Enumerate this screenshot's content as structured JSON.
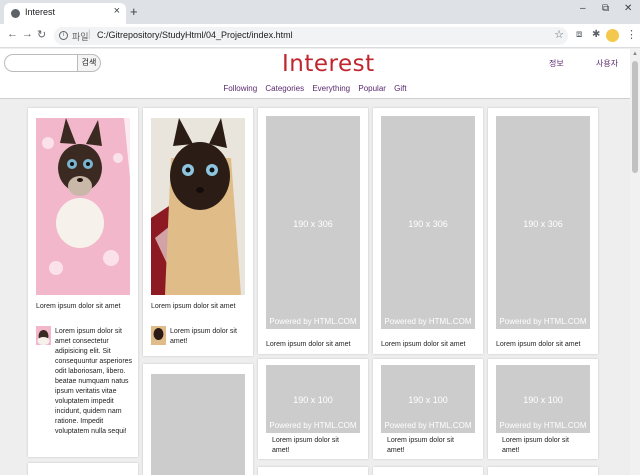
{
  "browser": {
    "tab_title": "Interest",
    "new_tab": "+",
    "tab_close": "×",
    "url_scheme": "파일",
    "url_separator": "|",
    "url": "C:/Gitrepository/StudyHtml/04_Project/index.html",
    "info_icon": "i",
    "window_min": "–",
    "window_max": "⧉",
    "window_close": "✕",
    "back": "←",
    "forward": "→",
    "reload": "↻",
    "star": "☆",
    "ext_puzzle": "✱",
    "ext_box": "⧈",
    "menu": "⋮"
  },
  "header": {
    "search_placeholder": "",
    "search_button": "검색",
    "logo": "Interest",
    "info_link": "정보",
    "user_link": "사용자"
  },
  "nav": {
    "items": [
      "Following",
      "Categories",
      "Everything",
      "Popular",
      "Gift"
    ]
  },
  "cards": {
    "c1": {
      "title": "Lorem ipsum dolor sit amet",
      "desc_lines": [
        "Lorem ipsum dolor sit",
        "amet consectetur",
        "adipisicing elit. Sit",
        "consequuntur asperiores",
        "odit laboriosam, libero.",
        "beatae numquam natus",
        "ipsum veritatis vitae",
        "voluptatem impedit",
        "incidunt, quidem nam",
        "ratione. Impedit",
        "voluptatem nulla sequi!"
      ]
    },
    "c2": {
      "title": "Lorem ipsum dolor sit amet",
      "desc_lines": [
        "Lorem ipsum dolor sit",
        "amet!"
      ]
    },
    "placeholders": {
      "large_size": "190 x 306",
      "small_size": "190 x 100",
      "credit": "Powered by HTML.COM",
      "title": "Lorem ipsum dolor sit amet",
      "small_desc_lines": [
        "Lorem ipsum dolor sit",
        "amet!"
      ]
    }
  },
  "icons": [
    "globe-icon",
    "search-icon",
    "star-icon",
    "puzzle-icon",
    "menu-icon",
    "info-icon"
  ]
}
